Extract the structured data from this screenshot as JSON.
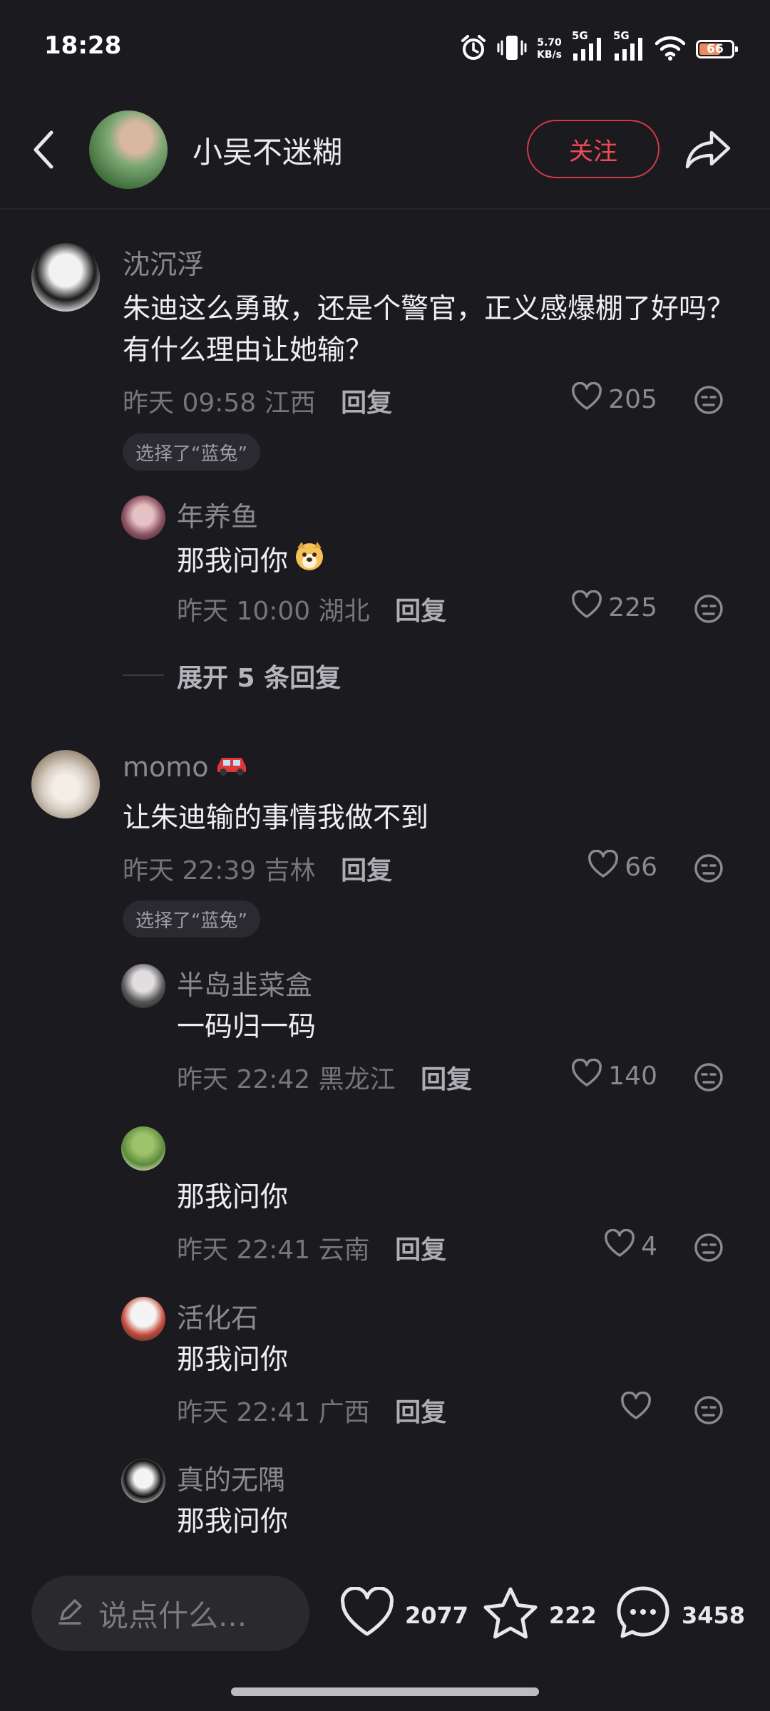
{
  "status_bar": {
    "time": "18:28",
    "net_speed": "5.70",
    "net_speed_unit": "KB/s",
    "sim1": "5G",
    "sim2": "5G",
    "battery": "66",
    "icons": [
      "alarm-icon",
      "vibrate-icon",
      "signal-icon",
      "signal-icon",
      "wifi-icon",
      "battery-icon"
    ]
  },
  "header": {
    "author": "小吴不迷糊",
    "follow_label": "关注",
    "icons": [
      "back-icon",
      "share-icon"
    ]
  },
  "comments": [
    {
      "name": "沈沉浮",
      "text": "朱迪这么勇敢，还是个警官，正义感爆棚了好吗？有什么理由让她输？",
      "time": "昨天 09:58",
      "location": "江西",
      "reply_label": "回复",
      "likes": "205",
      "chip": "选择了“蓝兔”",
      "replies": [
        {
          "name": "年养鱼",
          "text": "那我问你",
          "time": "昨天 10:00",
          "location": "湖北",
          "reply_label": "回复",
          "likes": "225"
        }
      ],
      "expand": "展开 5 条回复"
    },
    {
      "name": "momo",
      "text": "让朱迪输的事情我做不到",
      "time": "昨天 22:39",
      "location": "吉林",
      "reply_label": "回复",
      "likes": "66",
      "chip": "选择了“蓝兔”",
      "replies": [
        {
          "name": "半岛韭菜盒",
          "text": "一码归一码",
          "time": "昨天 22:42",
          "location": "黑龙江",
          "reply_label": "回复",
          "likes": "140"
        },
        {
          "name": "",
          "text": "那我问你",
          "time": "昨天 22:41",
          "location": "云南",
          "reply_label": "回复",
          "likes": "4"
        },
        {
          "name": "活化石",
          "text": "那我问你",
          "time": "昨天 22:41",
          "location": "广西",
          "reply_label": "回复",
          "likes": ""
        },
        {
          "name": "真的无隅",
          "text": "那我问你"
        }
      ]
    }
  ],
  "bottom_bar": {
    "input_placeholder": "说点什么...",
    "likes": "2077",
    "stars": "222",
    "comments": "3458"
  },
  "colors": {
    "background": "#1b1a1f",
    "accent": "#f04a55",
    "muted_text": "#8a8990"
  }
}
